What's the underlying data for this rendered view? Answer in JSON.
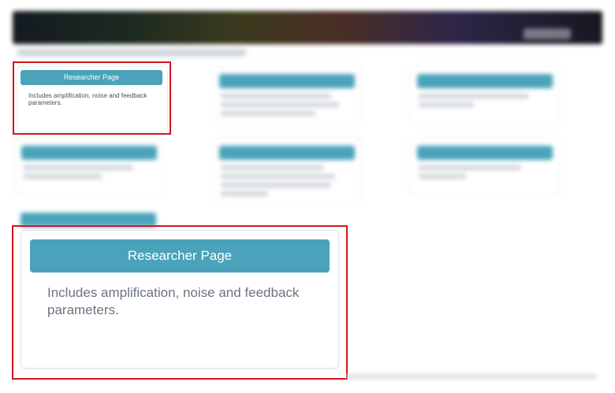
{
  "colors": {
    "accent": "#4aa3ba",
    "highlight": "#d0151d"
  },
  "featured_card": {
    "title": "Researcher Page",
    "description": "Includes amplification, noise and feedback parameters."
  }
}
